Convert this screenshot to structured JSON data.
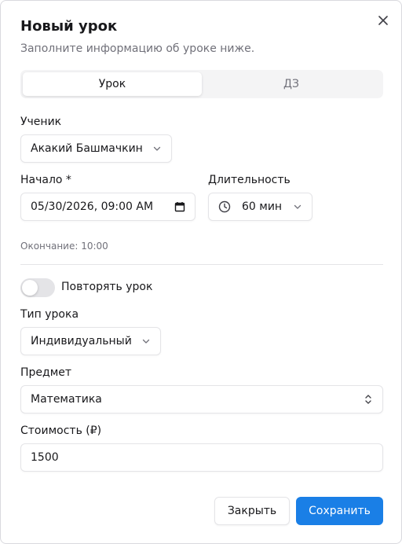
{
  "dialog": {
    "title": "Новый урок",
    "subtitle": "Заполните информацию об уроке ниже.",
    "close_icon": "close-icon"
  },
  "tabs": [
    {
      "label": "Урок",
      "active": true
    },
    {
      "label": "ДЗ",
      "active": false
    }
  ],
  "student": {
    "label": "Ученик",
    "value": "Акакий Башмачкин"
  },
  "start": {
    "label": "Начало *",
    "value": "05/30/2026, 09:00 AM",
    "icon": "calendar-icon"
  },
  "duration": {
    "label": "Длительность",
    "value": "60 мин",
    "icon": "clock-icon"
  },
  "end_hint": "Окончание: 10:00",
  "repeat": {
    "label": "Повторять урок",
    "enabled": false
  },
  "lesson_type": {
    "label": "Тип урока",
    "value": "Индивидуальный"
  },
  "subject": {
    "label": "Предмет",
    "value": "Математика"
  },
  "price": {
    "label": "Стоимость (₽)",
    "value": "1500"
  },
  "actions": {
    "close_label": "Закрыть",
    "save_label": "Сохранить"
  },
  "colors": {
    "primary": "#1a7fe6",
    "muted_text": "#71717a",
    "border": "#e4e4e7"
  }
}
